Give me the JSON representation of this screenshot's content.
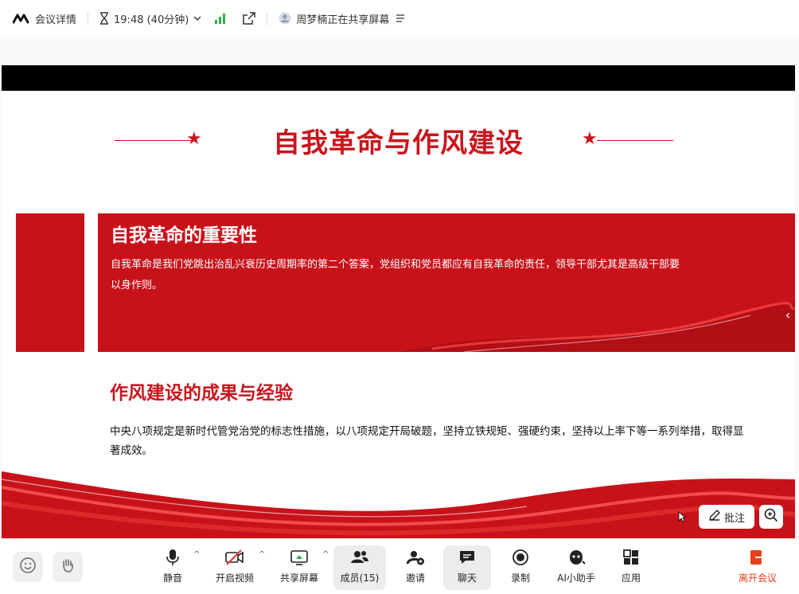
{
  "topbar": {
    "meeting_details": "会议详情",
    "time": "19:48 (40分钟)",
    "sharing_status": "周梦楠正在共享屏幕",
    "icons": [
      "tencent-meeting-logo-icon",
      "hourglass-icon",
      "chevron-down-icon",
      "signal-icon",
      "external-window-icon",
      "sharer-avatar-icon",
      "menu-icon"
    ]
  },
  "slide": {
    "title": "自我革命与作风建设",
    "banner_title": "自我革命的重要性",
    "banner_text": "自我革命是我们党跳出治乱兴衰历史周期率的第二个答案，党组织和党员都应有自我革命的责任，领导干部尤其是高级干部要以身作则。",
    "section_title": "作风建设的成果与经验",
    "section_text": "中央八项规定是新时代管党治党的标志性措施，以八项规定开局破题，坚持立铁规矩、强硬约束，坚持以上率下等一系列举措，取得显著成效。",
    "accent_color": "#c8121a"
  },
  "overlay": {
    "annotate_label": "批注"
  },
  "toolbar": {
    "mute": "静音",
    "video": "开启视频",
    "share": "共享屏幕",
    "members": "成员(15)",
    "invite": "邀请",
    "chat": "聊天",
    "record": "录制",
    "ai": "AI小助手",
    "apps": "应用",
    "leave": "离开会议",
    "leave_color": "#e8401c"
  }
}
